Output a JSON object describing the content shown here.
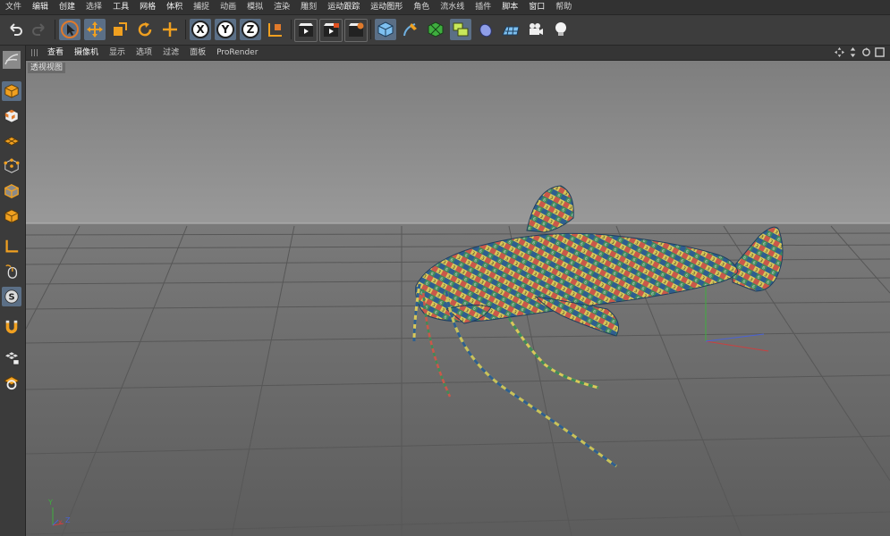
{
  "menubar": {
    "items": [
      "文件",
      "编辑",
      "创建",
      "选择",
      "工具",
      "网格",
      "体积",
      "捕捉",
      "动画",
      "模拟",
      "渲染",
      "雕刻",
      "运动跟踪",
      "运动图形",
      "角色",
      "流水线",
      "插件",
      "脚本",
      "窗口",
      "帮助"
    ]
  },
  "toolbar": {
    "icons": [
      "undo-icon",
      "redo-icon",
      "live-select-icon",
      "move-icon",
      "scale-icon",
      "rotate-icon",
      "add-icon",
      "x-axis-icon",
      "y-axis-icon",
      "z-axis-icon",
      "world-coord-icon",
      "render-view-icon",
      "render-picture-queue-icon",
      "render-settings-icon",
      "cube-object-icon",
      "pen-spline-icon",
      "subdivision-icon",
      "array-icon",
      "deformer-icon",
      "floor-icon",
      "camera-icon",
      "light-icon"
    ],
    "axis_letters": {
      "x": "X",
      "y": "Y",
      "z": "Z"
    }
  },
  "viewport_bar": {
    "items": [
      "查看",
      "摄像机",
      "显示",
      "选项",
      "过滤",
      "面板",
      "ProRender"
    ]
  },
  "viewport": {
    "label": "透视视图",
    "axis_labels": {
      "x": "x",
      "y": "Y",
      "z": "Z"
    }
  },
  "colors": {
    "accent_selected": "#5b6f86",
    "viewport_sky": "#8c8c8c",
    "viewport_floor": "#6a6a6a",
    "axis_x": "#c94040",
    "axis_y": "#3fae3f",
    "axis_z": "#4a63d6"
  }
}
